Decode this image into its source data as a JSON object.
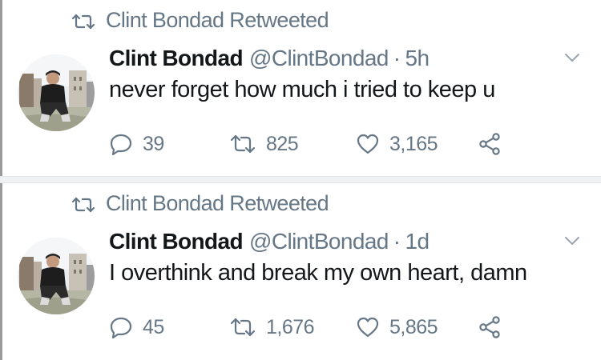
{
  "colors": {
    "text_primary": "#14171a",
    "text_secondary": "#657786",
    "divider": "#f0f1f3"
  },
  "icons": {
    "retweet": "retweet-icon",
    "reply": "reply-icon",
    "like": "heart-icon",
    "share": "share-icon",
    "menu": "chevron-down-icon"
  },
  "tweets": [
    {
      "retweeted_by": "Clint Bondad Retweeted",
      "name": "Clint Bondad",
      "handle": "@ClintBondad",
      "separator": "·",
      "time": "5h",
      "text": "never forget how much i tried to keep u",
      "replies": "39",
      "retweets": "825",
      "likes": "3,165"
    },
    {
      "retweeted_by": "Clint Bondad Retweeted",
      "name": "Clint Bondad",
      "handle": "@ClintBondad",
      "separator": "·",
      "time": "1d",
      "text": "I overthink and break my own heart, damn",
      "replies": "45",
      "retweets": "1,676",
      "likes": "5,865"
    }
  ]
}
